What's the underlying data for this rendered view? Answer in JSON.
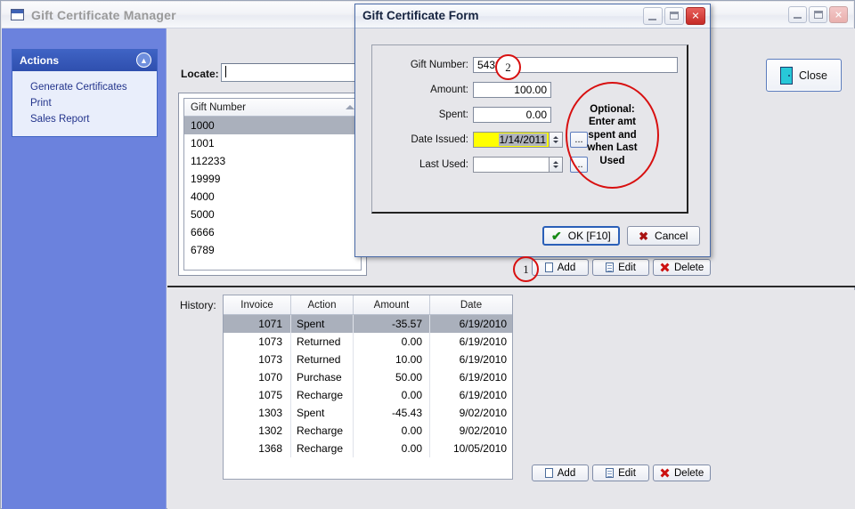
{
  "main_window": {
    "title": "Gift Certificate Manager",
    "window_buttons": {
      "minimize": "_",
      "maximize": "□",
      "close": "✕"
    }
  },
  "sidebar": {
    "panel_title": "Actions",
    "collapse_icon": "chevrons-up-icon",
    "items": [
      {
        "label": "Generate Certificates"
      },
      {
        "label": "Print"
      },
      {
        "label": "Sales Report"
      }
    ],
    "background_color": "#6b82dd",
    "header_color": "#3f63c4"
  },
  "toolbar": {
    "close_label": "Close"
  },
  "locate": {
    "label": "Locate:",
    "value": "",
    "placeholder": ""
  },
  "gift_list": {
    "column_header": "Gift Number",
    "sort_indicator": "ascending",
    "selected_index": 0,
    "rows": [
      "1000",
      "1001",
      "112233",
      "19999",
      "4000",
      "5000",
      "6666",
      "6789"
    ]
  },
  "record_buttons": {
    "add": "Add",
    "edit": "Edit",
    "delete": "Delete"
  },
  "history": {
    "label": "History:",
    "columns": [
      "Invoice",
      "Action",
      "Amount",
      "Date"
    ],
    "selected_index": 0,
    "rows": [
      {
        "invoice": "1071",
        "action": "Spent",
        "amount": "-35.57",
        "date": "6/19/2010"
      },
      {
        "invoice": "1073",
        "action": "Returned",
        "amount": "0.00",
        "date": "6/19/2010"
      },
      {
        "invoice": "1073",
        "action": "Returned",
        "amount": "10.00",
        "date": "6/19/2010"
      },
      {
        "invoice": "1070",
        "action": "Purchase",
        "amount": "50.00",
        "date": "6/19/2010"
      },
      {
        "invoice": "1075",
        "action": "Recharge",
        "amount": "0.00",
        "date": "6/19/2010"
      },
      {
        "invoice": "1303",
        "action": "Spent",
        "amount": "-45.43",
        "date": "9/02/2010"
      },
      {
        "invoice": "1302",
        "action": "Recharge",
        "amount": "0.00",
        "date": "9/02/2010"
      },
      {
        "invoice": "1368",
        "action": "Recharge",
        "amount": "0.00",
        "date": "10/05/2010"
      }
    ]
  },
  "dialog": {
    "title": "Gift Certificate Form",
    "window_buttons": {
      "minimize": "_",
      "maximize": "□",
      "close": "✕"
    },
    "fields": {
      "gift_number": {
        "label": "Gift Number:",
        "value": "54321"
      },
      "amount": {
        "label": "Amount:",
        "value": "100.00"
      },
      "spent": {
        "label": "Spent:",
        "value": "0.00"
      },
      "date_issued": {
        "label": "Date Issued:",
        "value": "1/14/2011",
        "highlight_color": "#ffff00",
        "ellipsis": "..."
      },
      "last_used": {
        "label": "Last Used:",
        "value": "",
        "ellipsis": "..."
      }
    },
    "buttons": {
      "ok": "OK [F10]",
      "cancel": "Cancel"
    }
  },
  "annotations": {
    "marker_1": "1",
    "marker_2": "2",
    "callout": "Optional:\nEnter amt\nspent and\nwhen Last\nUsed",
    "color": "#d81010"
  }
}
